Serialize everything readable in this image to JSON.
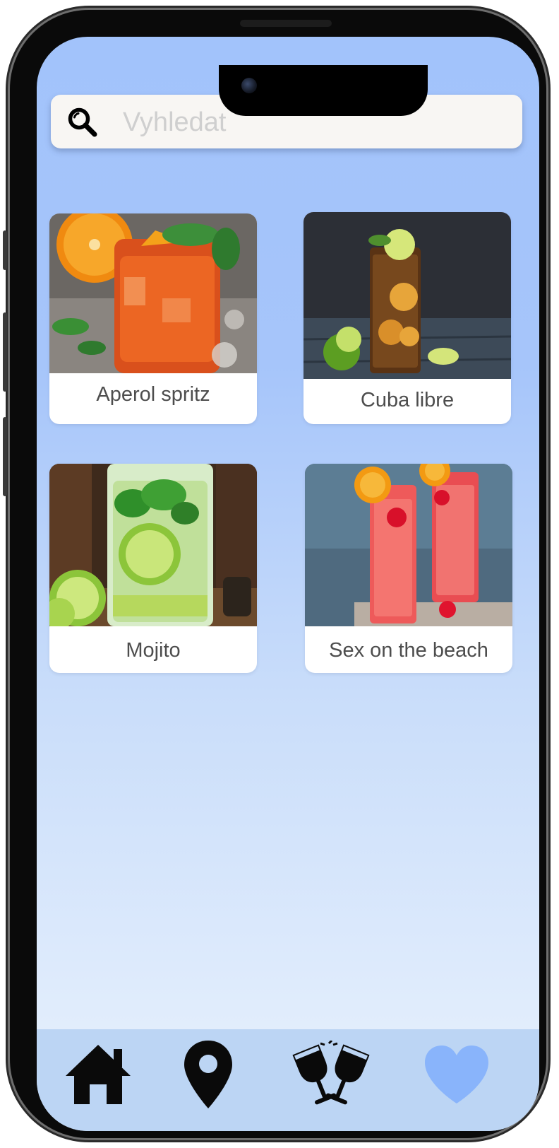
{
  "search": {
    "placeholder": "Vyhledat",
    "value": ""
  },
  "cocktails": [
    {
      "name": "Aperol spritz",
      "image": "aperol-spritz-photo"
    },
    {
      "name": "Cuba libre",
      "image": "cuba-libre-photo"
    },
    {
      "name": "Mojito",
      "image": "mojito-photo"
    },
    {
      "name": "Sex on the beach",
      "image": "sex-on-the-beach-photo"
    }
  ],
  "nav": {
    "items": [
      {
        "icon": "home-icon",
        "active": false
      },
      {
        "icon": "map-pin-icon",
        "active": false
      },
      {
        "icon": "cheers-glasses-icon",
        "active": false
      },
      {
        "icon": "heart-icon",
        "active": true
      }
    ]
  },
  "colors": {
    "background_top": "#a2c3fb",
    "background_bottom": "#e9f2fd",
    "nav_background": "#bcd5f4",
    "active_icon": "#89b4fb",
    "icon": "#0a0a0a",
    "search_background": "#f8f6f3"
  }
}
